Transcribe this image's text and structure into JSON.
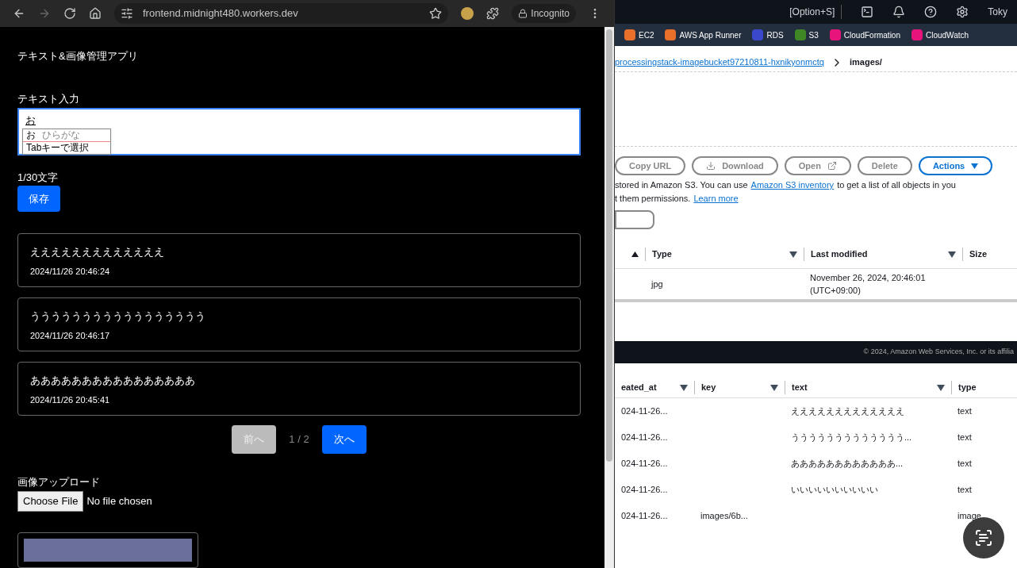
{
  "browser": {
    "url": "frontend.midnight480.workers.dev",
    "incognito": "Incognito"
  },
  "app": {
    "title": "テキスト&画像管理アプリ",
    "input_label": "テキスト入力",
    "input_value": "お",
    "ime": {
      "candidate": "お",
      "reading": "ひらがな",
      "hint": "Tabキーで選択"
    },
    "char_count": "1/30文字",
    "save": "保存",
    "entries": [
      {
        "text": "えええええええええええええ",
        "time": "2024/11/26 20:46:24"
      },
      {
        "text": "ううううううううううううううううう",
        "time": "2024/11/26 20:46:17"
      },
      {
        "text": "ああああああああああああああああ",
        "time": "2024/11/26 20:45:41"
      }
    ],
    "pagination": {
      "prev": "前へ",
      "prev_disabled": true,
      "page": "1 / 2",
      "next": "次へ",
      "next_disabled": false
    },
    "upload_label": "画像アップロード",
    "choose_file": "Choose File",
    "file_status": "No file chosen"
  },
  "console": {
    "shortcut": "[Option+S]",
    "account": "Toky",
    "services": [
      {
        "label": "EC2",
        "color": "#e8702a"
      },
      {
        "label": "AWS App Runner",
        "color": "#e8702a"
      },
      {
        "label": "RDS",
        "color": "#3b48cc"
      },
      {
        "label": "S3",
        "color": "#3f8624"
      },
      {
        "label": "CloudFormation",
        "color": "#e7157b"
      },
      {
        "label": "CloudWatch",
        "color": "#e7157b"
      }
    ],
    "breadcrumb": {
      "link": "processingstack-imagebucket97210811-hxnikyonmctq",
      "current": "images/"
    },
    "actions": [
      {
        "label": "Copy URL",
        "kind": "plain"
      },
      {
        "label": "Download",
        "kind": "download"
      },
      {
        "label": "Open",
        "kind": "external"
      },
      {
        "label": "Delete",
        "kind": "plain"
      },
      {
        "label": "Actions",
        "kind": "menu"
      }
    ],
    "info": {
      "before": "stored in Amazon S3. You can use",
      "link": "Amazon S3 inventory",
      "after": "to get a list of all objects in you",
      "line2": "t them permissions.",
      "learn_more": "Learn more"
    },
    "objects": {
      "columns": [
        "Type",
        "Last modified",
        "Size"
      ],
      "rows": [
        [
          "jpg",
          "November 26, 2024, 20:46:01 (UTC+09:00)"
        ]
      ]
    },
    "footer": "© 2024, Amazon Web Services, Inc. or its affilia",
    "items": {
      "columns": [
        "eated_at",
        "key",
        "text",
        "type"
      ],
      "rows": [
        [
          "024-11-26...",
          "",
          "えええええええええええええ",
          "text"
        ],
        [
          "024-11-26...",
          "",
          "ううううううううううううう...",
          "text"
        ],
        [
          "024-11-26...",
          "",
          "ああああああああああああ...",
          "text"
        ],
        [
          "024-11-26...",
          "",
          "いいいいいいいいいい",
          "text"
        ],
        [
          "024-11-26...",
          "images/6b...",
          "",
          "image"
        ]
      ]
    }
  }
}
